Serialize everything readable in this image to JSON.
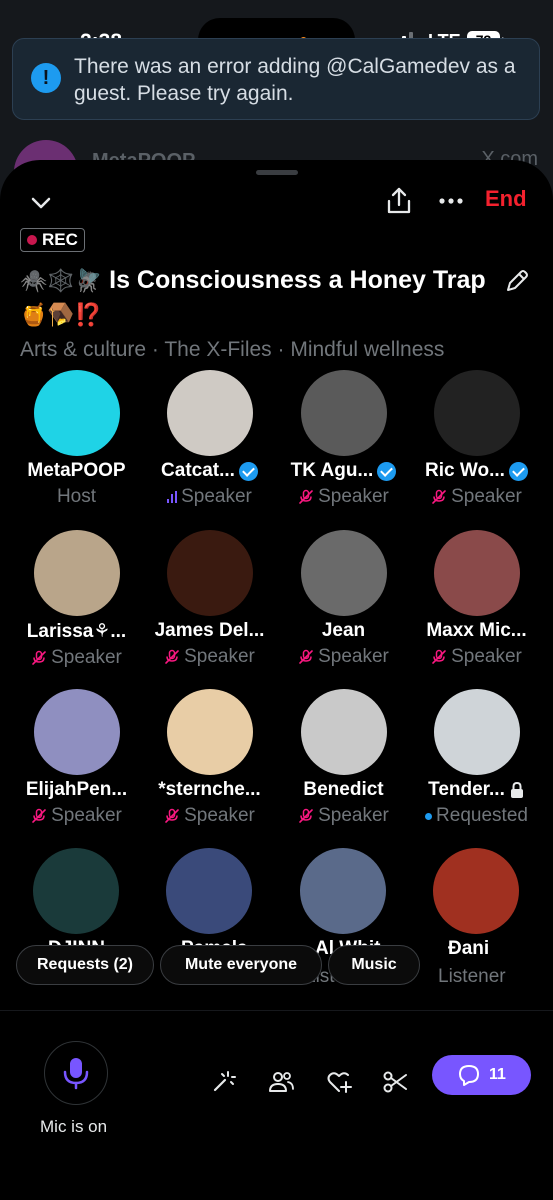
{
  "status": {
    "time": "2:38",
    "network": "LTE",
    "battery": "73"
  },
  "toast": {
    "message": "There was an error adding @CalGamedev as a guest. Please try again."
  },
  "background": {
    "peek_name": "MetaPOOP",
    "peek_x": "X.com"
  },
  "header": {
    "end_label": "End",
    "rec_label": "REC"
  },
  "space": {
    "title_emoji_prefix": "🕷️🕸️🪰",
    "title_text": "Is Consciousness a Honey Trap",
    "title_emoji_suffix": "🍯🪤⁉️",
    "topics": "Arts & culture · The X-Files · Mindful wellness"
  },
  "participants": [
    {
      "name": "MetaPOOP",
      "role": "Host",
      "verified": false,
      "status": "host",
      "avatar_color": "#1fd3e6"
    },
    {
      "name": "Catcat...",
      "role": "Speaker",
      "verified": true,
      "status": "speaking",
      "avatar_color": "#cfcac4"
    },
    {
      "name": "TK Agu...",
      "role": "Speaker",
      "verified": true,
      "status": "muted",
      "avatar_color": "#5a5a5a"
    },
    {
      "name": "Ric Wo...",
      "role": "Speaker",
      "verified": true,
      "status": "muted",
      "avatar_color": "#222222"
    },
    {
      "name": "Larissa⚘...",
      "role": "Speaker",
      "verified": false,
      "status": "muted",
      "avatar_color": "#b9a58a"
    },
    {
      "name": "James Del...",
      "role": "Speaker",
      "verified": false,
      "status": "muted",
      "avatar_color": "#3a1a10"
    },
    {
      "name": "Jean",
      "role": "Speaker",
      "verified": false,
      "status": "muted",
      "avatar_color": "#6a6a6a"
    },
    {
      "name": "Maxx Mic...",
      "role": "Speaker",
      "verified": false,
      "status": "muted",
      "avatar_color": "#8a4a4a"
    },
    {
      "name": "ElijahPen...",
      "role": "Speaker",
      "verified": false,
      "status": "muted",
      "avatar_color": "#8f8fc0"
    },
    {
      "name": "*sternche...",
      "role": "Speaker",
      "verified": false,
      "status": "muted",
      "avatar_color": "#e8cda6"
    },
    {
      "name": "Benedict",
      "role": "Speaker",
      "verified": false,
      "status": "muted",
      "avatar_color": "#c9c9c9"
    },
    {
      "name": "Tender...",
      "role": "Requested",
      "verified": false,
      "status": "requested",
      "avatar_color": "#cfd4d8"
    },
    {
      "name": "DJINN",
      "role": "Listener",
      "verified": false,
      "status": "listener",
      "avatar_color": "#1a3a3a"
    },
    {
      "name": "Pamela",
      "role": "Listener",
      "verified": true,
      "status": "listener",
      "avatar_color": "#3a4a7a"
    },
    {
      "name": "Al Whit...",
      "role": "Listener",
      "verified": false,
      "status": "listener",
      "avatar_color": "#5a6a8a"
    },
    {
      "name": "Ðani",
      "role": "Listener",
      "verified": false,
      "status": "listener",
      "avatar_color": "#a03020"
    }
  ],
  "actions": {
    "requests_label": "Requests (2)",
    "mute_label": "Mute everyone",
    "music_label": "Music"
  },
  "bottom": {
    "mic_label": "Mic is on",
    "chat_count": "11"
  },
  "colors": {
    "accent": "#7856ff",
    "end": "#f4212e",
    "verified": "#1d9bf0",
    "muted": "#f91880"
  }
}
